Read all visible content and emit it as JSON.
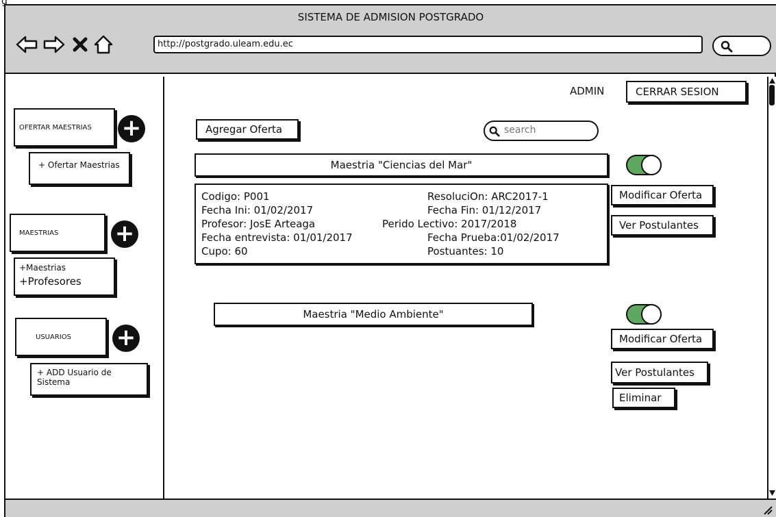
{
  "window": {
    "title": "SISTEMA DE ADMISION POSTGRADO",
    "url": "http://postgrado.uleam.edu.ec",
    "corner_label": "g"
  },
  "header": {
    "user": "ADMIN",
    "logout": "CERRAR SESION"
  },
  "sidebar": {
    "sections": [
      {
        "label": "OFERTAR MAESTRIAS",
        "items": [
          "+ Ofertar Maestrias"
        ]
      },
      {
        "label": "MAESTRIAS",
        "items": [
          "+Maestrias",
          "+Profesores"
        ]
      },
      {
        "label": "USUARIOS",
        "items": [
          "+ ADD Usuario de Sistema"
        ]
      }
    ]
  },
  "main": {
    "add_offer": "Agregar Oferta",
    "search_placeholder": "search",
    "offers": [
      {
        "title": "Maestria \"Ciencias del Mar\"",
        "enabled": true,
        "details": {
          "codigo": "Codigo: P001",
          "resolucion": "ResoluciOn: ARC2017-1",
          "fecha_ini": "Fecha Ini: 01/02/2017",
          "fecha_fin": "Fecha Fin: 01/12/2017",
          "profesor": "Profesor: JosE Arteaga",
          "periodo": "Perido Lectivo: 2017/2018",
          "fecha_entrevista": "Fecha entrevista: 01/01/2017",
          "fecha_prueba": "Fecha Prueba:01/02/2017",
          "cupo": "Cupo: 60",
          "postulantes": "Postuantes: 10"
        },
        "actions": [
          "Modificar Oferta",
          "Ver Postulantes"
        ]
      },
      {
        "title": "Maestria \"Medio Ambiente\"",
        "enabled": true,
        "actions": [
          "Modificar Oferta",
          "Ver Postulantes",
          "Eliminar"
        ]
      }
    ]
  },
  "colors": {
    "toggle_on": "#5fa860",
    "chrome": "#cfcfcf"
  }
}
